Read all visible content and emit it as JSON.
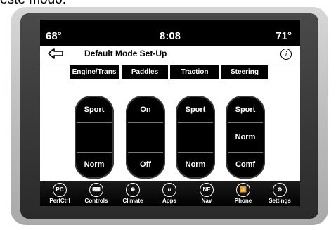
{
  "caption": "este modo.",
  "status": {
    "outside_temp_left": "68°",
    "time": "8:08",
    "outside_temp_right": "71°"
  },
  "header": {
    "title": "Default Mode Set-Up",
    "info": "i"
  },
  "columns": [
    {
      "label": "Engine/Trans",
      "top": "Sport",
      "middle": "",
      "bottom": "Norm"
    },
    {
      "label": "Paddles",
      "top": "On",
      "middle": "",
      "bottom": "Off"
    },
    {
      "label": "Traction",
      "top": "Sport",
      "middle": "",
      "bottom": "Norm"
    },
    {
      "label": "Steering",
      "top": "Sport",
      "middle": "Norm",
      "bottom": "Comf"
    }
  ],
  "nav": [
    {
      "label": "PerfCtrl",
      "icon": "perfctrl-icon",
      "glyph": "PC"
    },
    {
      "label": "Controls",
      "icon": "controls-icon",
      "glyph": "⌨"
    },
    {
      "label": "Climate",
      "icon": "climate-icon",
      "glyph": "❋"
    },
    {
      "label": "Apps",
      "icon": "apps-icon",
      "glyph": "u"
    },
    {
      "label": "Nav",
      "icon": "nav-icon",
      "glyph": "NE"
    },
    {
      "label": "Phone",
      "icon": "phone-icon",
      "glyph": "📶"
    },
    {
      "label": "Settings",
      "icon": "settings-icon",
      "glyph": "⚙"
    }
  ]
}
